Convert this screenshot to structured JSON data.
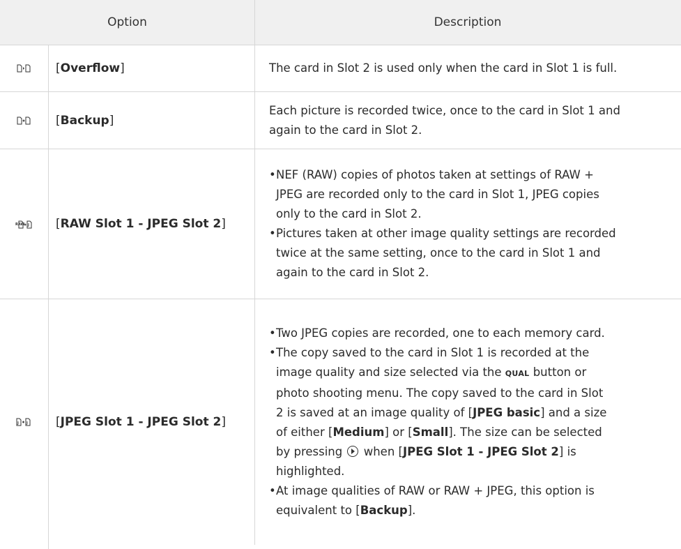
{
  "header": {
    "option": "Option",
    "description": "Description"
  },
  "rows": [
    {
      "icon": "overflow-icon",
      "option": "Overflow",
      "description": "The card in Slot 2 is used only when the card in Slot 1 is full."
    },
    {
      "icon": "backup-icon",
      "option": "Backup",
      "description_lines": [
        "Each picture is recorded twice, once to the card in Slot 1 and",
        "again to the card in Slot 2."
      ]
    },
    {
      "icon": "raw-jpeg-icon",
      "option": "RAW Slot 1 - JPEG Slot 2",
      "bullets": [
        {
          "lines": [
            "NEF (RAW) copies of photos taken at settings of RAW +",
            "JPEG are recorded only to the card in Slot 1, JPEG copies",
            "only to the card in Slot 2."
          ]
        },
        {
          "lines": [
            "Pictures taken at other image quality settings are recorded",
            "twice at the same setting, once to the card in Slot 1 and",
            "again to the card in Slot 2."
          ]
        }
      ]
    },
    {
      "icon": "jpeg-jpeg-icon",
      "option": "JPEG Slot 1 - JPEG Slot 2",
      "bullets": [
        {
          "lines": [
            "Two JPEG copies are recorded, one to each memory card."
          ]
        },
        {
          "l1": "The copy saved to the card in Slot 1 is recorded at the",
          "l2_a": "image quality and size selected via the ",
          "l2_qual": "QUAL",
          "l2_b": " button or",
          "l3": "photo shooting menu. The copy saved to the card in Slot",
          "l4_a": "2 is saved at an image quality of [",
          "l4_bold": "JPEG basic",
          "l4_b": "] and a size",
          "l5_a": "of either [",
          "l5_bold1": "Medium",
          "l5_b": "] or [",
          "l5_bold2": "Small",
          "l5_c": "]. The size can be selected",
          "l6_a": "by pressing ",
          "l6_b": " when [",
          "l6_bold": "JPEG Slot 1 - JPEG Slot 2",
          "l6_c": "] is",
          "l7": "highlighted."
        },
        {
          "l1": "At image qualities of RAW or RAW + JPEG, this option is",
          "l2_a": "equivalent to [",
          "l2_bold": "Backup",
          "l2_b": "]."
        }
      ]
    }
  ],
  "symbols": {
    "bullet": "•",
    "open_bracket": "[",
    "close_bracket": "]"
  }
}
